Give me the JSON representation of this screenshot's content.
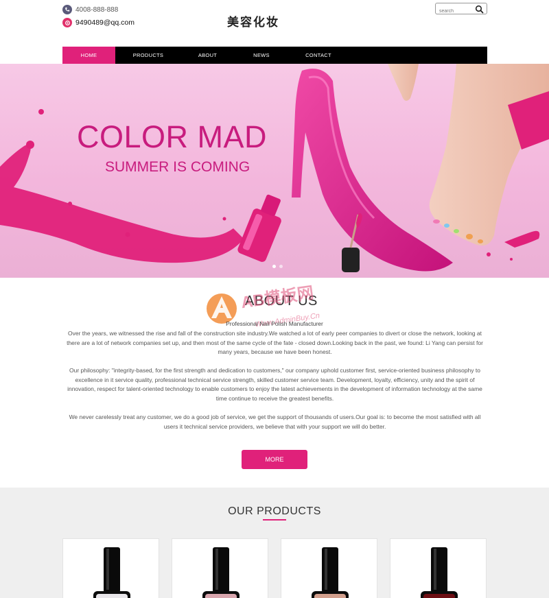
{
  "header": {
    "phone": "4008-888-888",
    "email": "9490489@qq.com",
    "brand": "美容化妆",
    "search_placeholder": "search"
  },
  "nav": {
    "items": [
      {
        "label": "HOME",
        "active": true
      },
      {
        "label": "PRODUCTS",
        "active": false
      },
      {
        "label": "ABOUT",
        "active": false
      },
      {
        "label": "NEWS",
        "active": false
      },
      {
        "label": "CONTACT",
        "active": false
      }
    ]
  },
  "banner": {
    "title": "COLOR MAD",
    "subtitle": "SUMMER IS COMING",
    "slide_count": 2,
    "active_slide": 1
  },
  "about": {
    "title": "ABOUT US",
    "subtitle": "Professional Nail Polish Manufacturer",
    "p1": "Over the years, we witnessed the rise and fall of the construction site industry.We watched a lot of early peer companies to divert or close the network, looking at there are a lot of network companies set up, and then most of the same cycle of the fate - closed down.Looking back in the past, we found: Li Yang can persist for many years, because we have been honest.",
    "p2": "Our philosophy: \"integrity-based, for the first strength and dedication to customers,\" our company uphold customer first, service-oriented business philosophy to excellence in it service quality, professional technical service strength, skilled customer service team. Development, loyalty, efficiency, unity and the spirit of innovation, respect for talent-oriented technology to enable customers to enjoy the latest achievements in the development of information technology at the same time continue to receive the greatest benefits.",
    "p3": "We never carelessly treat any customer, we do a good job of service, we get the support of thousands of users.Our goal is: to become the most satisfied with all users it technical service providers, we believe that with your support we will do better.",
    "more_label": "MORE"
  },
  "watermark": {
    "logo_text": "AB模板网",
    "url_text": "Www.AdminBuy.Cn"
  },
  "products": {
    "title": "OUR PRODUCTS",
    "items": [
      {
        "name": "nail-polish-white",
        "color": "#e9e6ea"
      },
      {
        "name": "nail-polish-pink",
        "color": "#d9a6ae"
      },
      {
        "name": "nail-polish-nude",
        "color": "#d3a08e"
      },
      {
        "name": "nail-polish-burgundy",
        "color": "#6e0f14"
      }
    ]
  },
  "colors": {
    "accent": "#e0217a",
    "nav_bg": "#000000",
    "banner_text": "#c81c7e"
  }
}
